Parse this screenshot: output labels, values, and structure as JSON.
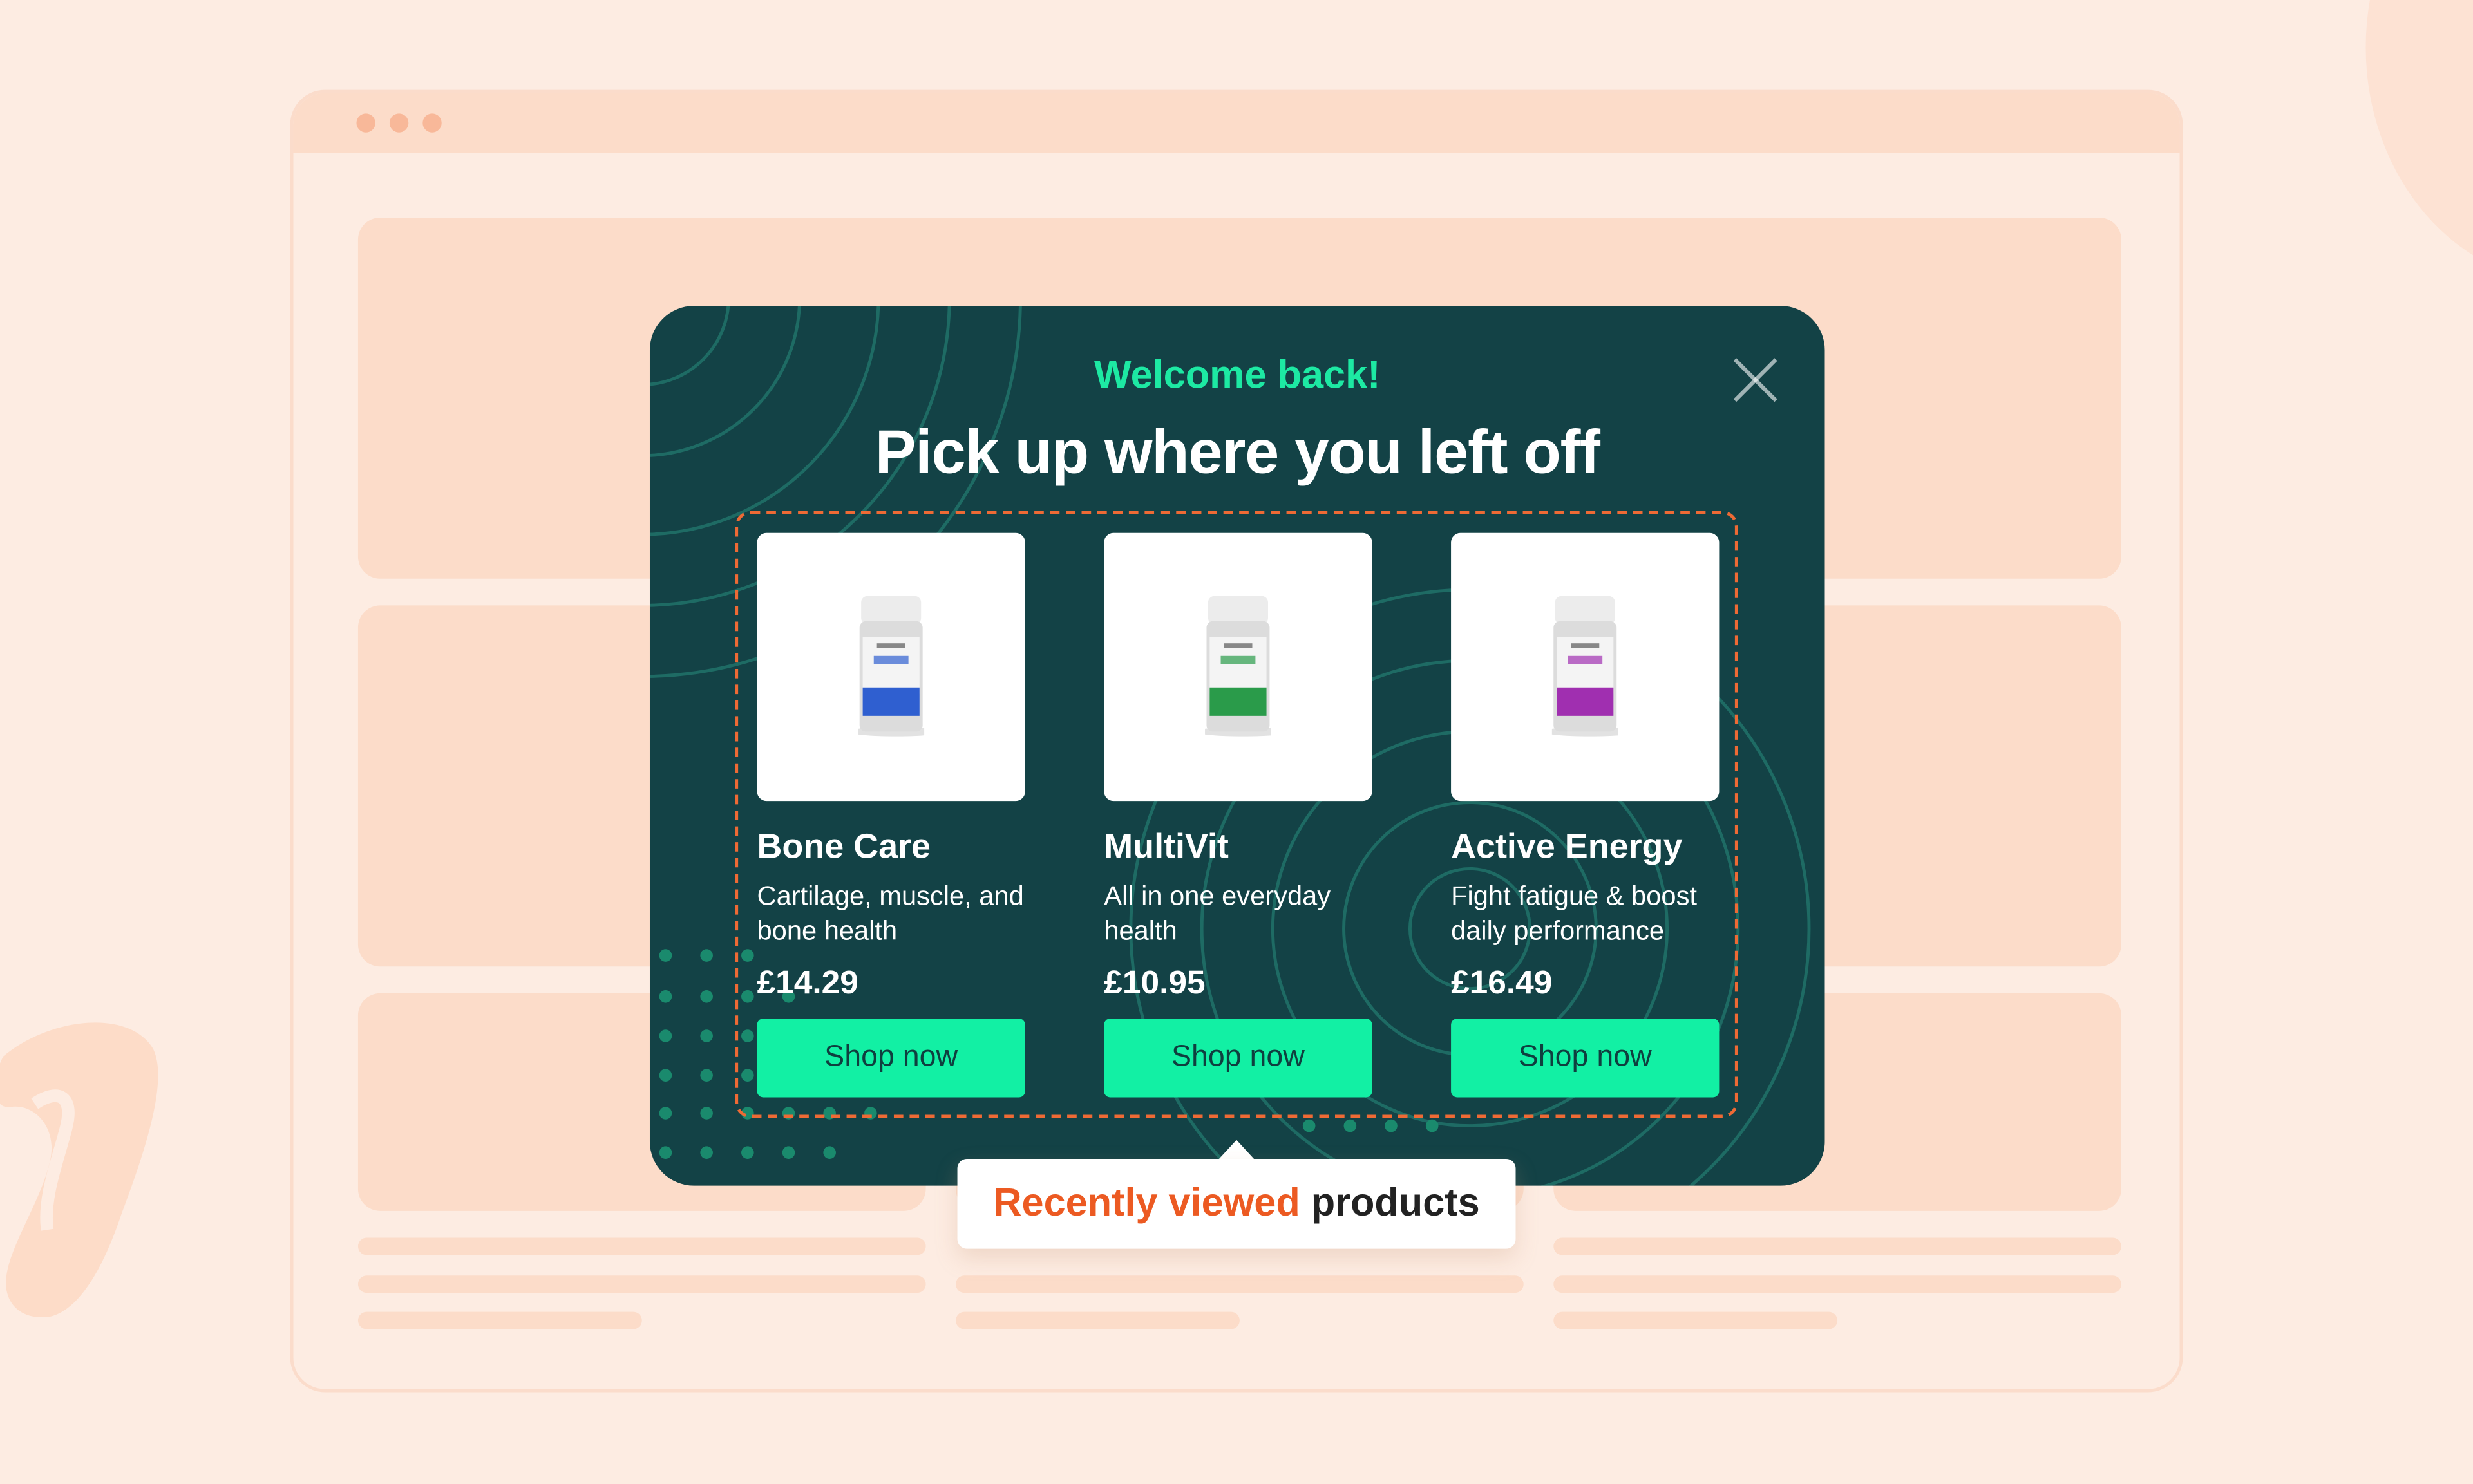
{
  "popup": {
    "eyebrow": "Welcome back!",
    "title": "Pick up where you left off",
    "products": [
      {
        "name": "Bone Care",
        "description": "Cartilage, muscle, and bone health",
        "price": "£14.29",
        "cta": "Shop now",
        "label_color": "#2f5fd0"
      },
      {
        "name": "MultiVit",
        "description": "All in one everyday health",
        "price": "£10.95",
        "cta": "Shop now",
        "label_color": "#2a9b4a"
      },
      {
        "name": "Active Energy",
        "description": "Fight fatigue & boost daily performance",
        "price": "£16.49",
        "cta": "Shop now",
        "label_color": "#a02fb0"
      }
    ]
  },
  "callout": {
    "accent_text": "Recently viewed",
    "text": "products"
  },
  "colors": {
    "background": "#fdece2",
    "popup_bg": "#134246",
    "accent_green": "#12f0a4",
    "accent_orange": "#ec5a22"
  },
  "icons": {
    "close": "close-icon"
  }
}
